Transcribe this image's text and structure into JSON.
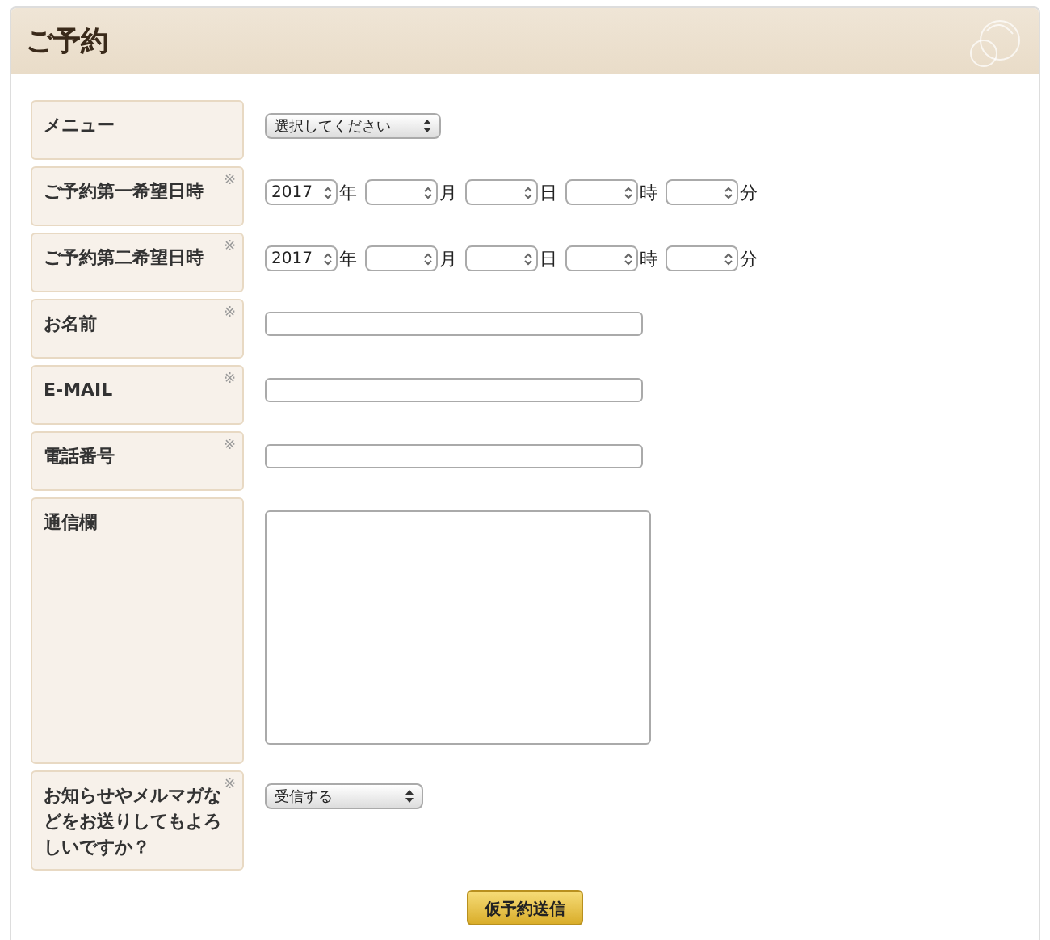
{
  "header": {
    "title": "ご予約"
  },
  "rows": [
    {
      "kind": "select",
      "label": "メニュー",
      "required": false,
      "value": "選択してください"
    },
    {
      "kind": "datetime",
      "label": "ご予約第一希望日時",
      "required": true,
      "parts": [
        {
          "value": "2017",
          "unit": "年"
        },
        {
          "unit": "月"
        },
        {
          "unit": "日"
        },
        {
          "unit": "時"
        },
        {
          "unit": "分"
        }
      ]
    },
    {
      "kind": "datetime",
      "label": "ご予約第二希望日時",
      "required": true,
      "parts": [
        {
          "value": "2017",
          "unit": "年"
        },
        {
          "unit": "月"
        },
        {
          "unit": "日"
        },
        {
          "unit": "時"
        },
        {
          "unit": "分"
        }
      ]
    },
    {
      "kind": "text",
      "label": "お名前",
      "required": true
    },
    {
      "kind": "text",
      "label": "E-MAIL",
      "required": true
    },
    {
      "kind": "text",
      "label": "電話番号",
      "required": true
    },
    {
      "kind": "textarea",
      "label": "通信欄",
      "required": false
    },
    {
      "kind": "select",
      "label": "お知らせやメルマガなどをお送りしてもよろしいですか？",
      "required": true,
      "value": "受信する"
    }
  ],
  "submit": {
    "label": "仮予約送信"
  },
  "required_mark": "※"
}
